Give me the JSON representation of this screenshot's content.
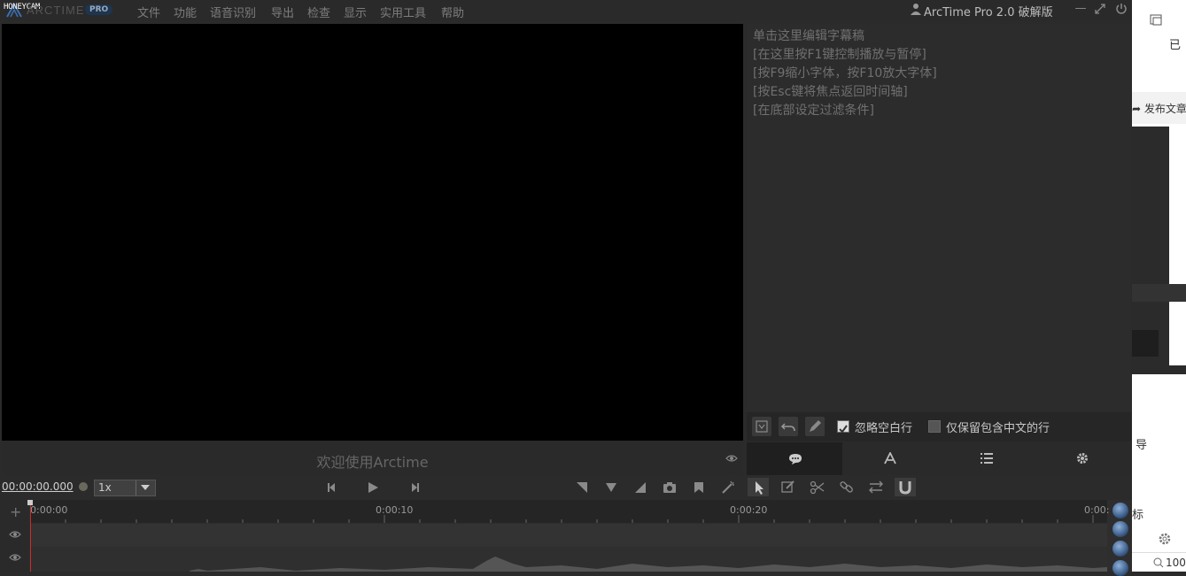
{
  "watermark": "HONEYCAM",
  "logo": {
    "text": "ARCTIME",
    "badge": "PRO"
  },
  "menu": [
    "文件",
    "功能",
    "语音识别",
    "导出",
    "检查",
    "显示",
    "实用工具",
    "帮助"
  ],
  "app_title": "ArcTime Pro 2.0 破解版",
  "icons": {
    "user": "user-icon",
    "minimize": "minimize-icon",
    "maximize": "maximize-icon",
    "power": "power-icon"
  },
  "subtitle_hints": [
    "单击这里编辑字幕稿",
    "[在这里按F1键控制播放与暂停]",
    "[按F9缩小字体，按F10放大字体]",
    "[按Esc键将焦点返回时间轴]",
    "[在底部设定过滤条件]"
  ],
  "welcome": "欢迎使用Arctime",
  "filters": {
    "ignore_empty": "忽略空白行",
    "ignore_empty_checked": true,
    "keep_chinese": "仅保留包含中文的行",
    "keep_chinese_checked": false
  },
  "tabs": [
    "chat-icon",
    "font-icon",
    "list-icon",
    "gear-icon"
  ],
  "transport": {
    "timecode": "00:00:00.000",
    "speed": "1x"
  },
  "timeline": {
    "labels": [
      "0:00:00",
      "0:00:10",
      "0:00:20",
      "0:00:"
    ]
  },
  "background_window": {
    "texts": [
      "已",
      "发布文章",
      "导",
      "标",
      "100"
    ]
  }
}
